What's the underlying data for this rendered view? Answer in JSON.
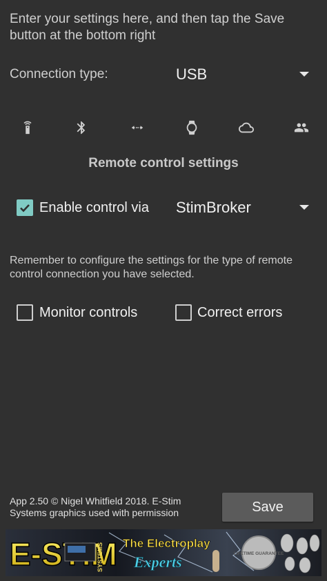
{
  "intro_text": "Enter your settings here, and then tap the Save button at the bottom right",
  "connection": {
    "label": "Connection type:",
    "value": "USB"
  },
  "connection_icons": [
    "remote-icon",
    "bluetooth-icon",
    "network-arrows-icon",
    "watch-icon",
    "cloud-icon",
    "people-icon"
  ],
  "remote_section": {
    "title": "Remote control settings",
    "enable": {
      "checked": true,
      "label": "Enable control via"
    },
    "via_value": "StimBroker",
    "remember_text": "Remember to configure the settings for the type of remote control connection you have selected.",
    "monitor": {
      "checked": false,
      "label": "Monitor controls"
    },
    "correct": {
      "checked": false,
      "label": "Correct errors"
    }
  },
  "footer": {
    "credits": "App 2.50 © Nigel Whitfield 2018. E-Stim Systems graphics used with permission",
    "save_label": "Save"
  },
  "banner": {
    "brand": "E-STIM",
    "side_text": "SYSTEMS",
    "tagline_line1": "The Electroplay",
    "tagline_line2": "Experts",
    "seal_text": "LIFETIME GUARANTEE"
  },
  "colors": {
    "background": "#303030",
    "accent": "#80cbc4",
    "button": "#5b5b5b"
  }
}
